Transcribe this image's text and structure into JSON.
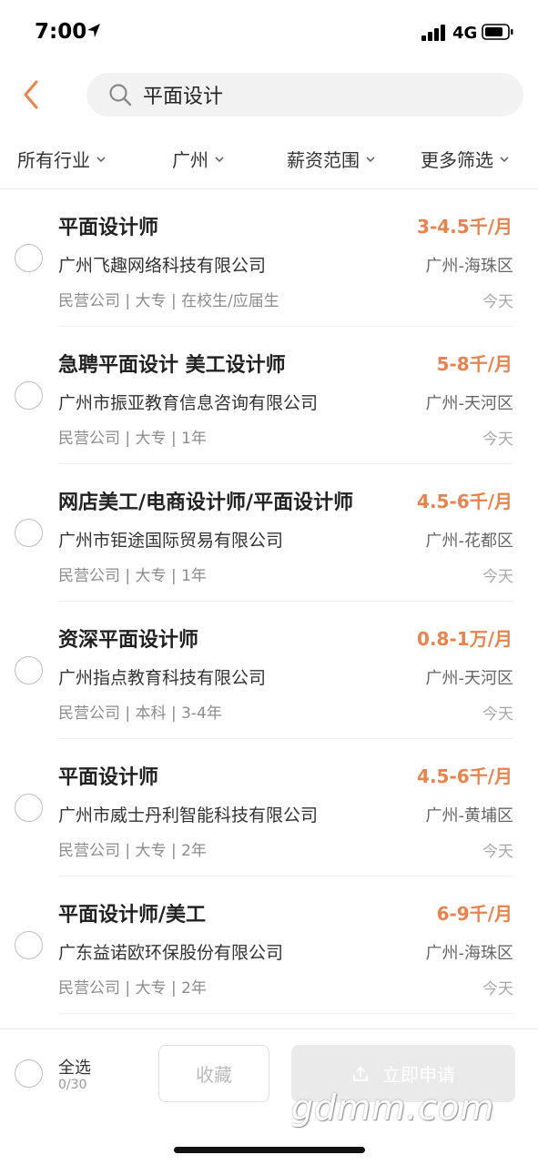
{
  "status_bar": {
    "time": "7:00",
    "network": "4G"
  },
  "search": {
    "query": "平面设计"
  },
  "filters": [
    {
      "label": "所有行业"
    },
    {
      "label": "广州"
    },
    {
      "label": "薪资范围"
    },
    {
      "label": "更多筛选"
    }
  ],
  "jobs": [
    {
      "title": "平面设计师",
      "salary": "3-4.5千/月",
      "company": "广州飞趣网络科技有限公司",
      "area": "广州-海珠区",
      "tags": "民营公司 | 大专 | 在校生/应届生",
      "date": "今天"
    },
    {
      "title": "急聘平面设计  美工设计师",
      "salary": "5-8千/月",
      "company": "广州市振亚教育信息咨询有限公司",
      "area": "广州-天河区",
      "tags": "民营公司 | 大专 | 1年",
      "date": "今天"
    },
    {
      "title": "网店美工/电商设计师/平面设计师",
      "salary": "4.5-6千/月",
      "company": "广州市钜途国际贸易有限公司",
      "area": "广州-花都区",
      "tags": "民营公司 | 大专 | 1年",
      "date": "今天"
    },
    {
      "title": "资深平面设计师",
      "salary": "0.8-1万/月",
      "company": "广州指点教育科技有限公司",
      "area": "广州-天河区",
      "tags": "民营公司 | 本科 | 3-4年",
      "date": "今天"
    },
    {
      "title": "平面设计师",
      "salary": "4.5-6千/月",
      "company": "广州市威士丹利智能科技有限公司",
      "area": "广州-黄埔区",
      "tags": "民营公司 | 大专 | 2年",
      "date": "今天"
    },
    {
      "title": "平面设计师/美工",
      "salary": "6-9千/月",
      "company": "广东益诺欧环保股份有限公司",
      "area": "广州-海珠区",
      "tags": "民营公司 | 大专 | 2年",
      "date": "今天"
    }
  ],
  "bottom_bar": {
    "select_all_label": "全选",
    "select_count": "0/30",
    "favorite_label": "收藏",
    "apply_label": "立即申请"
  },
  "watermark": "gdmm.com",
  "colors": {
    "accent": "#e8834e",
    "salary": "#e8834e",
    "disabled_button": "#eaeaea"
  }
}
